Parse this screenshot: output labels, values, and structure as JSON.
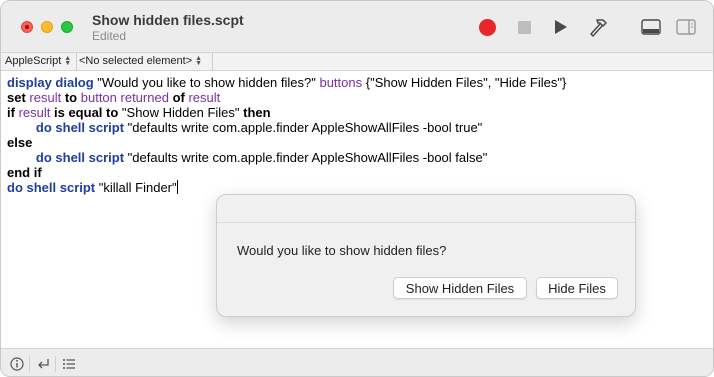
{
  "window": {
    "title": "Show hidden files.scpt",
    "subtitle": "Edited"
  },
  "toolbar": {
    "record_icon": "record-icon",
    "stop_icon": "stop-icon",
    "run_icon": "run-icon",
    "compile_icon": "hammer-icon",
    "show_log_icon": "log-panel-icon",
    "show_sidebar_icon": "sidebar-icon",
    "record_color": "#e8262a"
  },
  "navbar": {
    "language": "AppleScript",
    "element": "<No selected element>"
  },
  "editor": {
    "lines": [
      [
        {
          "t": "display dialog",
          "s": "kw-blue"
        },
        {
          "t": " \"Would you like to show hidden files?\" ",
          "s": ""
        },
        {
          "t": "buttons",
          "s": "kw-purple"
        },
        {
          "t": " {\"Show Hidden Files\", \"Hide Files\"}",
          "s": ""
        }
      ],
      [
        {
          "t": "set",
          "s": "kw-bold"
        },
        {
          "t": " ",
          "s": ""
        },
        {
          "t": "result",
          "s": "kw-purple"
        },
        {
          "t": " ",
          "s": ""
        },
        {
          "t": "to",
          "s": "kw-bold"
        },
        {
          "t": " ",
          "s": ""
        },
        {
          "t": "button returned",
          "s": "kw-purple"
        },
        {
          "t": " ",
          "s": ""
        },
        {
          "t": "of",
          "s": "kw-bold"
        },
        {
          "t": " ",
          "s": ""
        },
        {
          "t": "result",
          "s": "kw-purple"
        }
      ],
      [
        {
          "t": "if",
          "s": "kw-bold"
        },
        {
          "t": " ",
          "s": ""
        },
        {
          "t": "result",
          "s": "kw-purple"
        },
        {
          "t": " ",
          "s": ""
        },
        {
          "t": "is equal to",
          "s": "kw-bold"
        },
        {
          "t": " \"Show Hidden Files\" ",
          "s": ""
        },
        {
          "t": "then",
          "s": "kw-bold"
        }
      ],
      [
        {
          "t": "        ",
          "s": ""
        },
        {
          "t": "do shell script",
          "s": "kw-blue"
        },
        {
          "t": " \"defaults write com.apple.finder AppleShowAllFiles -bool true\"",
          "s": ""
        }
      ],
      [
        {
          "t": "else",
          "s": "kw-bold"
        }
      ],
      [
        {
          "t": "        ",
          "s": ""
        },
        {
          "t": "do shell script",
          "s": "kw-blue"
        },
        {
          "t": " \"defaults write com.apple.finder AppleShowAllFiles -bool false\"",
          "s": ""
        }
      ],
      [
        {
          "t": "end if",
          "s": "kw-bold"
        }
      ],
      [
        {
          "t": "do shell script",
          "s": "kw-blue"
        },
        {
          "t": " \"killall Finder\"",
          "s": ""
        }
      ]
    ]
  },
  "footer": {
    "info_icon": "info-icon",
    "return_icon": "return-icon",
    "list_icon": "list-icon"
  },
  "dialog": {
    "message": "Would you like to show hidden files?",
    "buttons": [
      "Show Hidden Files",
      "Hide Files"
    ]
  }
}
